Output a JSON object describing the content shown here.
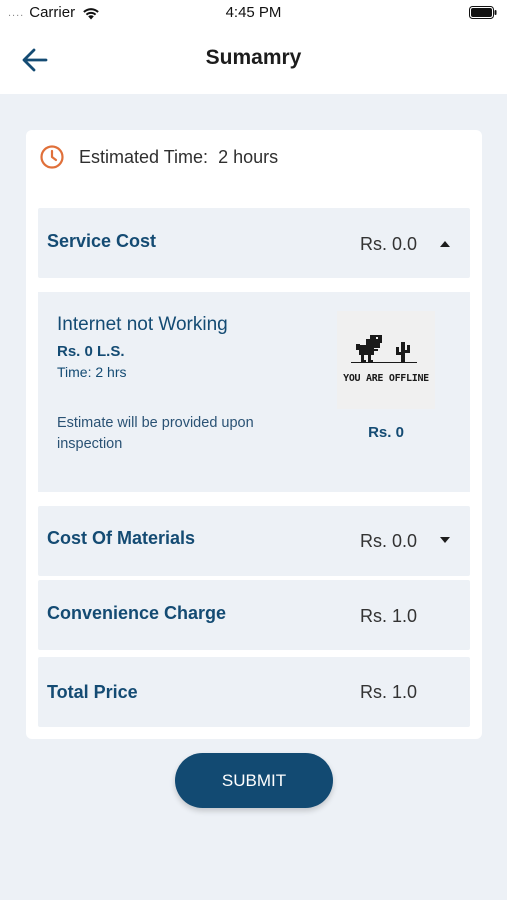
{
  "status_bar": {
    "signal": "....",
    "carrier": "Carrier",
    "time": "4:45 PM"
  },
  "nav": {
    "title": "Sumamry"
  },
  "estimate": {
    "label": "Estimated Time:",
    "value": "2 hours"
  },
  "service_cost": {
    "title": "Service Cost",
    "amount": "Rs. 0.0",
    "expanded": true
  },
  "service_item": {
    "title": "Internet not Working",
    "price": "Rs. 0 L.S.",
    "time": "Time: 2 hrs",
    "note": "Estimate will be provided upon inspection",
    "image_caption": "YOU ARE OFFLINE",
    "amount": "Rs. 0"
  },
  "materials": {
    "title": "Cost Of Materials",
    "amount": "Rs. 0.0",
    "expanded": false
  },
  "convenience": {
    "title": "Convenience Charge",
    "amount": "Rs. 1.0"
  },
  "total": {
    "title": "Total Price",
    "amount": "Rs. 1.0"
  },
  "submit_label": "SUBMIT",
  "colors": {
    "primary": "#144b73",
    "button": "#124a72",
    "accent_clock": "#e0703a",
    "background": "#edf1f6"
  },
  "icons": [
    "back-arrow-icon",
    "clock-icon",
    "caret-up-icon",
    "caret-down-icon",
    "wifi-icon",
    "battery-icon"
  ]
}
